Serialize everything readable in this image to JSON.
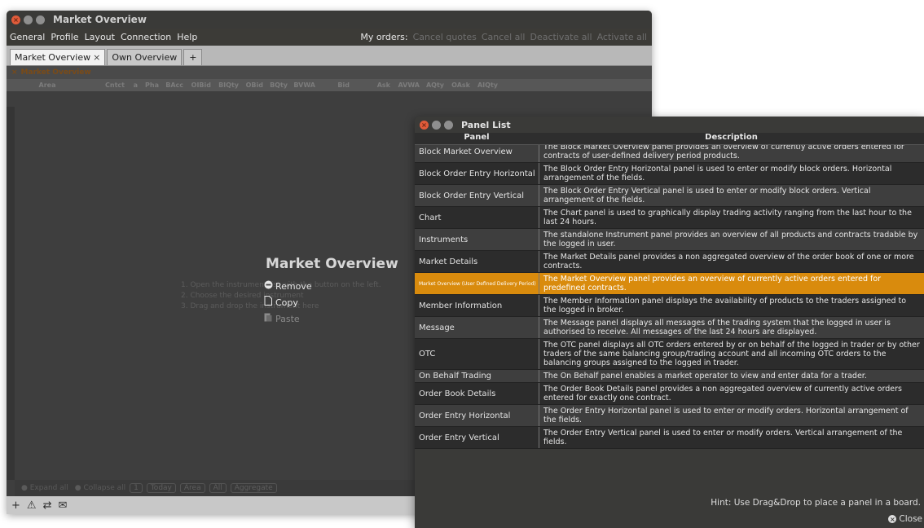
{
  "main_window": {
    "title": "Market Overview",
    "menu": [
      "General",
      "Profile",
      "Layout",
      "Connection",
      "Help"
    ],
    "orders_label": "My orders:",
    "order_actions": [
      "Cancel quotes",
      "Cancel all",
      "Deactivate all",
      "Activate all"
    ],
    "tabs": [
      {
        "label": "Market Overview",
        "close": "×"
      },
      {
        "label": "Own Overview"
      }
    ],
    "add_tab": "+",
    "panel_title": "Market Overview",
    "columns": [
      "Area",
      "Cntct",
      "a",
      "Pha",
      "BAcc",
      "OIBid",
      "BIQty",
      "OBid",
      "BQty",
      "BVWA",
      "Bid",
      "Ask",
      "AVWA",
      "AQty",
      "OAsk",
      "AIQty"
    ],
    "board_title": "Market Overview",
    "steps": [
      "1. Open the instrument list with the  button on the left.",
      "2. Choose the desired instrument",
      "3. Drag and drop the instrument here"
    ],
    "context_menu": [
      {
        "label": "Remove",
        "enabled": true,
        "icon": "minus-circle-icon"
      },
      {
        "label": "Copy",
        "enabled": true,
        "icon": "page-icon"
      },
      {
        "label": "Paste",
        "enabled": false,
        "icon": "clipboard-icon"
      }
    ],
    "bottom_toolbar": [
      "Expand all",
      "Collapse all",
      "1",
      "Today",
      "Area",
      "All",
      "Aggregate"
    ],
    "status_icons": [
      "+",
      "⚠",
      "⇄",
      "✉"
    ]
  },
  "panel_list": {
    "title": "Panel List",
    "header_panel": "Panel",
    "header_description": "Description",
    "rows": [
      {
        "panel": "Block Market Overview",
        "description": "The Block Market Overview panel provides an overview of currently active orders entered for contracts of user-defined delivery period products."
      },
      {
        "panel": "Block Order Entry Horizontal",
        "description": "The Block Order Entry Horizontal panel is used to enter or modify block orders. Horizontal arrangement of the fields."
      },
      {
        "panel": "Block Order Entry Vertical",
        "description": "The Block Order Entry Vertical panel is used to enter or modify block orders. Vertical arrangement of the fields."
      },
      {
        "panel": "Chart",
        "description": "The Chart panel is used to graphically display trading activity ranging from the last hour to the last 24 hours."
      },
      {
        "panel": "Instruments",
        "description": "The standalone Instrument panel provides an overview of all products and contracts tradable by the logged in user."
      },
      {
        "panel": "Market Details",
        "description": "The Market Details panel provides a non aggregated overview of the order book of one or more contracts."
      },
      {
        "panel": "Market Overview (User Defined Delivery Period)",
        "description": "The Market Overview panel provides an overview of currently active orders entered for predefined contracts."
      },
      {
        "panel": "Member Information",
        "description": "The Member Information panel displays the availability of products to the traders assigned to the logged in broker."
      },
      {
        "panel": "Message",
        "description": "The Message panel displays all messages of the trading system that the logged in user is authorised to receive. All messages of the last 24 hours are displayed."
      },
      {
        "panel": "OTC",
        "description": "The OTC panel displays all OTC orders entered by or on behalf of the logged in trader or by other traders of the same balancing group/trading account and all incoming OTC orders to the balancing groups assigned to the logged in trader."
      },
      {
        "panel": "On Behalf Trading",
        "description": "The On Behalf panel enables a market operator to view and enter data for a trader."
      },
      {
        "panel": "Order Book Details",
        "description": "The Order Book Details panel provides a non aggregated overview of currently active orders entered for exactly one contract."
      },
      {
        "panel": "Order Entry Horizontal",
        "description": "The Order Entry Horizontal panel is used to enter or modify orders. Horizontal arrangement of the fields."
      },
      {
        "panel": "Order Entry Vertical",
        "description": "The Order Entry Vertical panel is used to enter or modify orders. Vertical arrangement of the fields."
      }
    ],
    "selected_index": 6,
    "hint": "Hint: Use Drag&Drop to place a panel in a board.",
    "close_label": "Close"
  }
}
